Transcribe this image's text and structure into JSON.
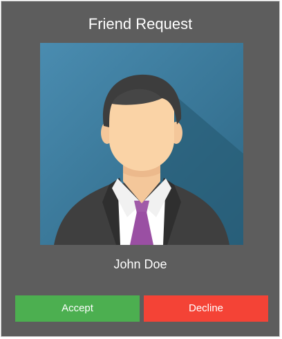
{
  "dialog": {
    "title": "Friend Request",
    "avatar_icon": "user-avatar-icon",
    "name": "John Doe",
    "accept_label": "Accept",
    "decline_label": "Decline"
  },
  "colors": {
    "dialog_background": "#5d5d5d",
    "avatar_background": "#3f7fa0",
    "accept": "#4caf50",
    "decline": "#f44336",
    "tie": "#a05aa8"
  }
}
